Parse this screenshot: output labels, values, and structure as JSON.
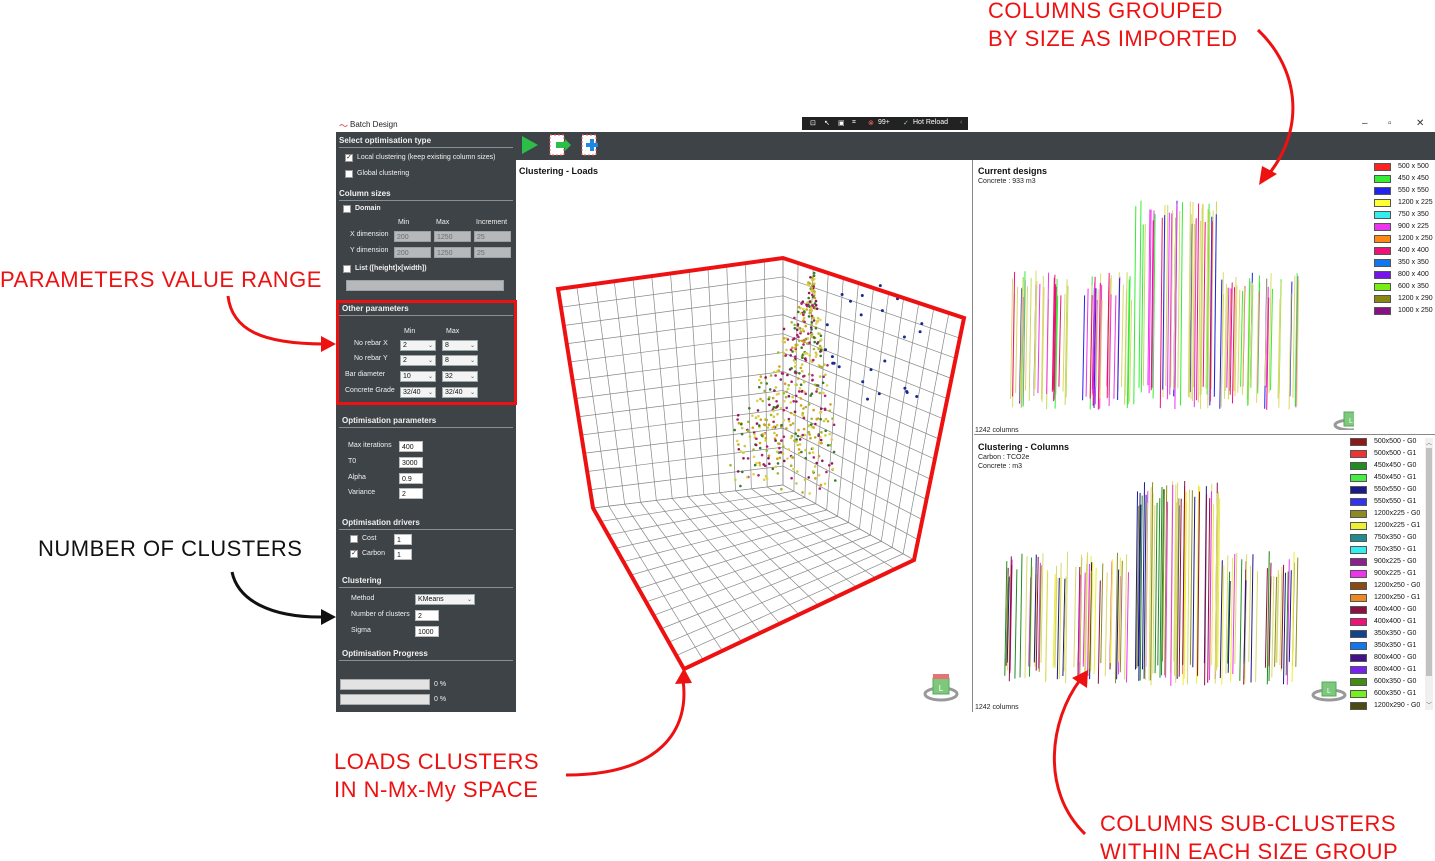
{
  "annotations": {
    "columns_grouped_l1": "COLUMNS GROUPED",
    "columns_grouped_l2": "BY SIZE AS IMPORTED",
    "parameters_range": "PARAMETERS VALUE RANGE",
    "number_clusters": "NUMBER OF CLUSTERS",
    "loads_clusters_l1": "LOADS CLUSTERS",
    "loads_clusters_l2": "IN N-Mx-My SPACE",
    "sub_clusters_l1": "COLUMNS SUB-CLUSTERS",
    "sub_clusters_l2": "WITHIN EACH SIZE GROUP",
    "arrow_color_red": "#ee1111",
    "arrow_color_black": "#111111"
  },
  "window": {
    "title": "Batch Design",
    "devbar_count": "99+",
    "devbar_reload": "Hot Reload",
    "minimize": "–",
    "maximize": "▫",
    "close": "✕"
  },
  "sidebar": {
    "opt_type_title": "Select optimisation type",
    "local_clustering": "Local clustering (keep existing column sizes)",
    "local_checked": true,
    "global_clustering": "Global clustering",
    "global_checked": false,
    "column_sizes_title": "Column sizes",
    "domain_label": "Domain",
    "col_min": "Min",
    "col_max": "Max",
    "col_increment": "Increment",
    "x_dimension": "X dimension",
    "x_min": "200",
    "x_max": "1250",
    "x_inc": "25",
    "y_dimension": "Y dimension",
    "y_min": "200",
    "y_max": "1250",
    "y_inc": "25",
    "list_label": "List ([height]x[width])",
    "other_params_title": "Other parameters",
    "op_min": "Min",
    "op_max": "Max",
    "no_rebar_x": "No rebar X",
    "rebar_x_min": "2",
    "rebar_x_max": "8",
    "no_rebar_y": "No rebar Y",
    "rebar_y_min": "2",
    "rebar_y_max": "8",
    "bar_diameter": "Bar diameter",
    "bar_min": "10",
    "bar_max": "32",
    "concrete_grade": "Concrete Grade",
    "grade_min": "32/40",
    "grade_max": "32/40",
    "optimisation_params_title": "Optimisation parameters",
    "max_iterations": "Max iterations",
    "max_iterations_val": "400",
    "t0": "T0",
    "t0_val": "3000",
    "alpha": "Alpha",
    "alpha_val": "0.9",
    "variance": "Variance",
    "variance_val": "2",
    "drivers_title": "Optimisation drivers",
    "cost": "Cost",
    "cost_val": "1",
    "cost_checked": false,
    "carbon": "Carbon",
    "carbon_val": "1",
    "carbon_checked": true,
    "clustering_title": "Clustering",
    "method": "Method",
    "method_val": "KMeans",
    "num_clusters": "Number of clusters",
    "num_clusters_val": "2",
    "sigma": "Sigma",
    "sigma_val": "1000",
    "progress_title": "Optimisation Progress",
    "progress1": "0 %",
    "progress1_value": 0,
    "progress2": "0 %",
    "progress2_value": 0
  },
  "panels": {
    "loads_title": "Clustering - Loads",
    "current_title": "Current designs",
    "current_concrete": "Concrete : 933 m3",
    "current_count": "1242 columns",
    "columns_title": "Clustering - Columns",
    "columns_carbon": "Carbon :  TCO2e",
    "columns_concrete": "Concrete :  m3",
    "columns_count": "1242 columns",
    "nav_cube_letter": "L"
  },
  "legend_current": [
    {
      "label": "500 x 500",
      "color": "#ff2020"
    },
    {
      "label": "450 x 450",
      "color": "#33ee33"
    },
    {
      "label": "550 x 550",
      "color": "#2222ee"
    },
    {
      "label": "1200 x 225",
      "color": "#ffff33"
    },
    {
      "label": "750 x 350",
      "color": "#33eeee"
    },
    {
      "label": "900 x 225",
      "color": "#ee33ee"
    },
    {
      "label": "1200 x 250",
      "color": "#ff8811"
    },
    {
      "label": "400 x 400",
      "color": "#ee1177"
    },
    {
      "label": "350 x 350",
      "color": "#1177ee"
    },
    {
      "label": "800 x 400",
      "color": "#7711ee"
    },
    {
      "label": "600 x 350",
      "color": "#77ee11"
    },
    {
      "label": "1200 x 290",
      "color": "#888811"
    },
    {
      "label": "1000 x 250",
      "color": "#881188"
    }
  ],
  "legend_columns": [
    {
      "label": "500x500 - G0",
      "color": "#8b1a1a"
    },
    {
      "label": "500x500 - G1",
      "color": "#ee3333"
    },
    {
      "label": "450x450 - G0",
      "color": "#228b22"
    },
    {
      "label": "450x450 - G1",
      "color": "#44ee44"
    },
    {
      "label": "550x550 - G0",
      "color": "#1a1a8b"
    },
    {
      "label": "550x550 - G1",
      "color": "#3333ee"
    },
    {
      "label": "1200x225 - G0",
      "color": "#8b8b22"
    },
    {
      "label": "1200x225 - G1",
      "color": "#eeee33"
    },
    {
      "label": "750x350 - G0",
      "color": "#228b8b"
    },
    {
      "label": "750x350 - G1",
      "color": "#33eeee"
    },
    {
      "label": "900x225 - G0",
      "color": "#8b228b"
    },
    {
      "label": "900x225 - G1",
      "color": "#ee33ee"
    },
    {
      "label": "1200x250 - G0",
      "color": "#8b4a11"
    },
    {
      "label": "1200x250 - G1",
      "color": "#ee8822"
    },
    {
      "label": "400x400 - G0",
      "color": "#8b1144"
    },
    {
      "label": "400x400 - G1",
      "color": "#ee1177"
    },
    {
      "label": "350x350 - G0",
      "color": "#11448b"
    },
    {
      "label": "350x350 - G1",
      "color": "#1177ee"
    },
    {
      "label": "800x400 - G0",
      "color": "#44118b"
    },
    {
      "label": "800x400 - G1",
      "color": "#7722ee"
    },
    {
      "label": "600x350 - G0",
      "color": "#448b11"
    },
    {
      "label": "600x350 - G1",
      "color": "#77ee22"
    },
    {
      "label": "1200x290 - G0",
      "color": "#4a4a11"
    }
  ],
  "colors": {
    "sidebar_bg": "#3e4347",
    "highlight_frame": "#ee1111",
    "play_green": "#2dbe4a",
    "column_default": "#d9d96a"
  }
}
